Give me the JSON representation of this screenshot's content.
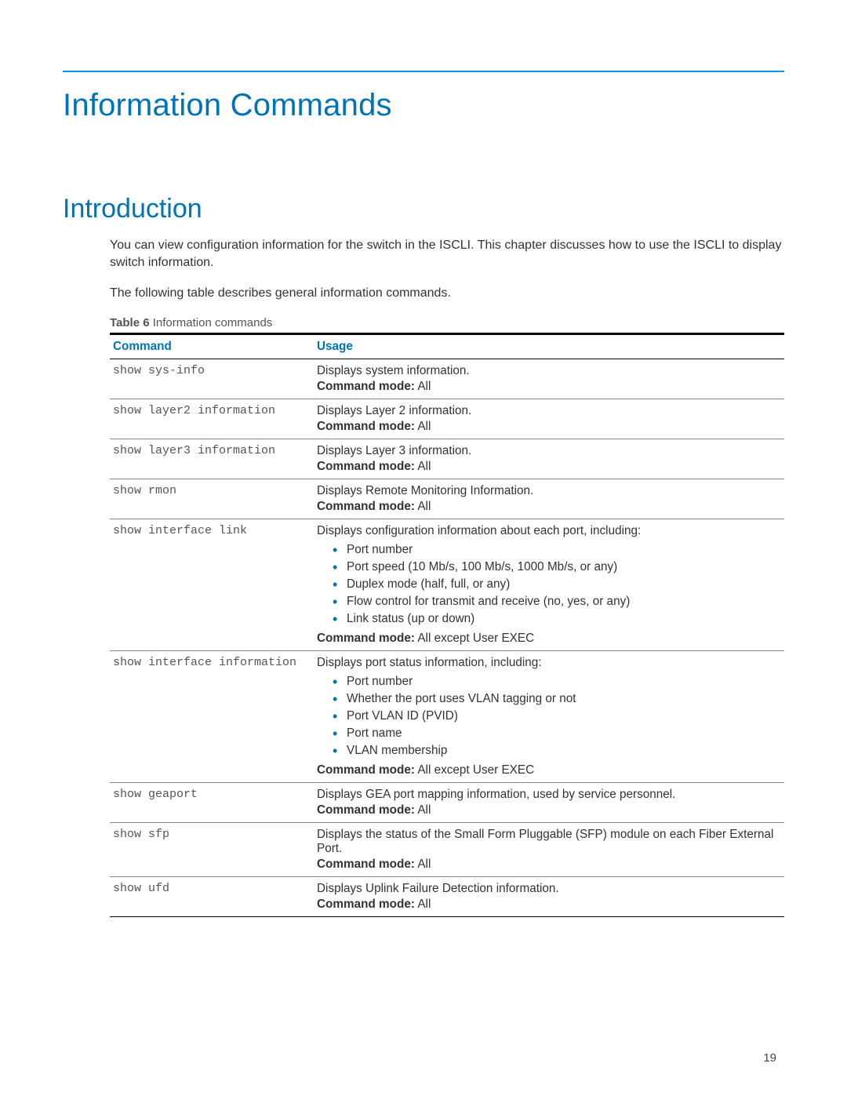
{
  "page": {
    "title": "Information Commands",
    "section": "Introduction",
    "intro_para1": "You can view configuration information for the switch in the ISCLI. This chapter discusses how to use the ISCLI to display switch information.",
    "intro_para2": "The following table describes general information commands.",
    "table_caption_label": "Table 6",
    "table_caption_title": " Information commands",
    "page_number": "19"
  },
  "table": {
    "header_command": "Command",
    "header_usage": "Usage",
    "cmd_mode_label": "Command mode:",
    "rows": [
      {
        "command": "show sys-info",
        "usage": "Displays system information.",
        "mode": " All"
      },
      {
        "command": "show layer2 information",
        "usage": "Displays Layer 2 information.",
        "mode": " All"
      },
      {
        "command": "show layer3 information",
        "usage": "Displays Layer 3 information.",
        "mode": " All"
      },
      {
        "command": "show rmon",
        "usage": "Displays Remote Monitoring Information.",
        "mode": " All"
      },
      {
        "command": "show interface link",
        "usage": "Displays configuration information about each port, including:",
        "bullets": [
          "Port number",
          "Port speed (10 Mb/s, 100 Mb/s, 1000 Mb/s, or any)",
          "Duplex mode (half, full, or any)",
          "Flow control for transmit and receive (no, yes, or any)",
          "Link status (up or down)"
        ],
        "mode": " All except User EXEC"
      },
      {
        "command": "show interface information",
        "usage": "Displays port status information, including:",
        "bullets": [
          "Port number",
          "Whether the port uses VLAN tagging or not",
          "Port VLAN ID (PVID)",
          "Port name",
          "VLAN membership"
        ],
        "mode": " All except User EXEC"
      },
      {
        "command": "show geaport",
        "usage": "Displays GEA port mapping information, used by service personnel.",
        "mode": " All"
      },
      {
        "command": "show sfp",
        "usage": "Displays the status of the Small Form Pluggable (SFP) module on each Fiber External Port.",
        "mode": " All"
      },
      {
        "command": "show ufd",
        "usage": "Displays Uplink Failure Detection information.",
        "mode": " All"
      }
    ]
  }
}
